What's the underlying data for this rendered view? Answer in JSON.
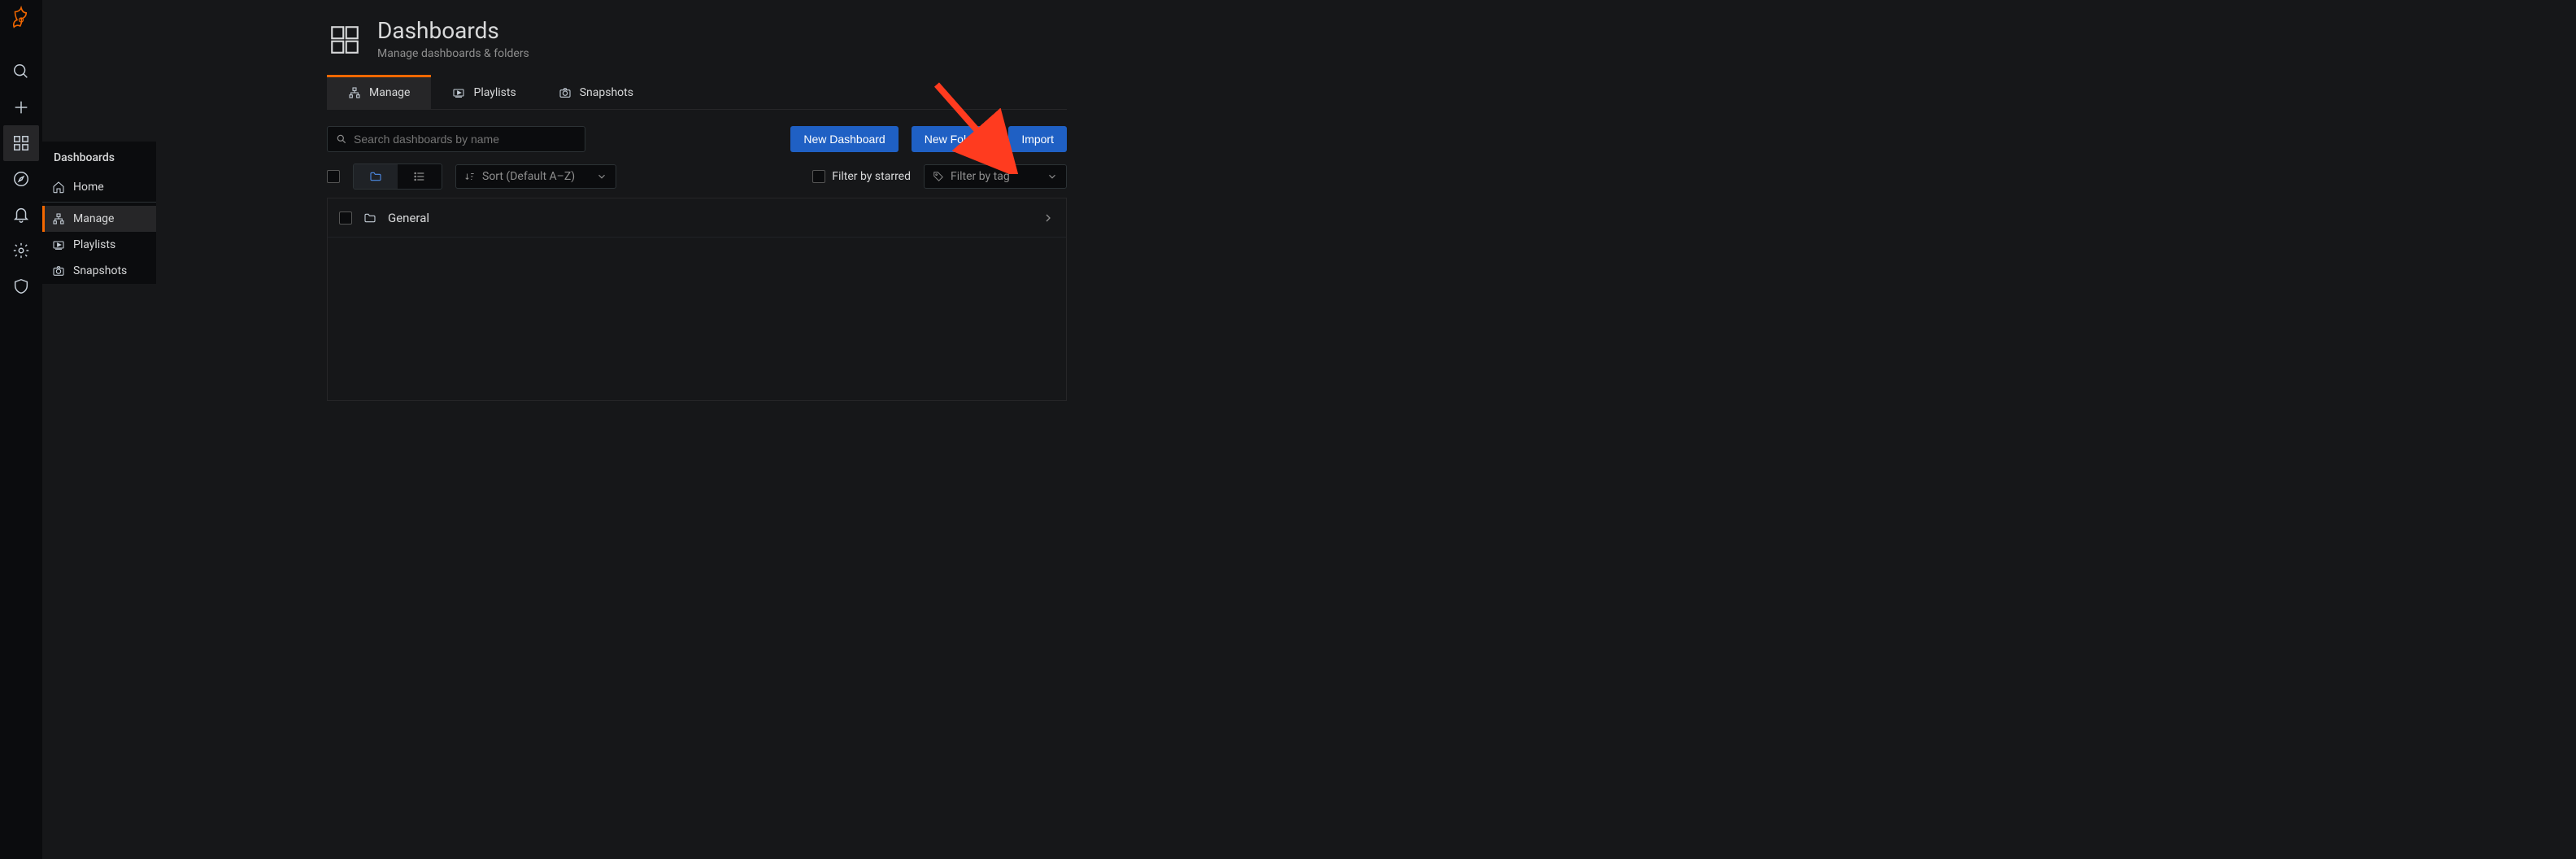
{
  "rail": {
    "items": [
      {
        "name": "logo",
        "icon": "logo"
      },
      {
        "name": "search",
        "icon": "search"
      },
      {
        "name": "create",
        "icon": "plus"
      },
      {
        "name": "dashboards",
        "icon": "apps",
        "active": true
      },
      {
        "name": "explore",
        "icon": "compass"
      },
      {
        "name": "alerting",
        "icon": "bell"
      },
      {
        "name": "configuration",
        "icon": "cog"
      },
      {
        "name": "admin",
        "icon": "shield"
      }
    ]
  },
  "flyout": {
    "title": "Dashboards",
    "items": [
      {
        "icon": "home",
        "label": "Home"
      },
      {
        "icon": "sitemap",
        "label": "Manage",
        "active": true
      },
      {
        "icon": "playlist",
        "label": "Playlists"
      },
      {
        "icon": "camera",
        "label": "Snapshots"
      }
    ]
  },
  "header": {
    "title": "Dashboards",
    "subtitle": "Manage dashboards & folders"
  },
  "tabs": [
    {
      "icon": "sitemap",
      "label": "Manage",
      "active": true
    },
    {
      "icon": "playlist",
      "label": "Playlists"
    },
    {
      "icon": "camera",
      "label": "Snapshots"
    }
  ],
  "search": {
    "placeholder": "Search dashboards by name"
  },
  "buttons": {
    "new_dashboard": "New Dashboard",
    "new_folder": "New Folder",
    "import": "Import"
  },
  "filters": {
    "sort_label": "Sort (Default A–Z)",
    "starred_label": "Filter by starred",
    "tag_label": "Filter by tag"
  },
  "rows": [
    {
      "icon": "folder",
      "label": "General"
    }
  ]
}
